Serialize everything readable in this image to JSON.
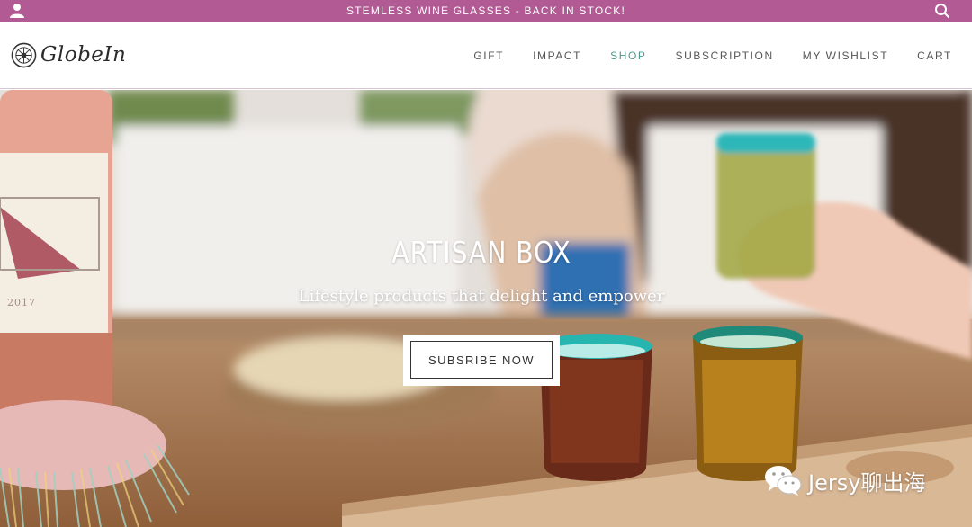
{
  "announcement": {
    "text": "STEMLESS WINE GLASSES - BACK IN STOCK!",
    "bar_color": "#b15a93"
  },
  "header": {
    "logo_text": "GlobeIn",
    "nav": [
      {
        "label": "GIFT",
        "active": false
      },
      {
        "label": "IMPACT",
        "active": false
      },
      {
        "label": "SHOP",
        "active": true
      },
      {
        "label": "SUBSCRIPTION",
        "active": false
      },
      {
        "label": "MY WISHLIST",
        "active": false
      },
      {
        "label": "CART",
        "active": false
      }
    ],
    "active_color": "#4d9a8a"
  },
  "hero": {
    "title": "ARTISAN BOX",
    "subtitle": "Lifestyle products that delight and empower",
    "cta_label": "SUBSRIBE NOW"
  },
  "watermark": {
    "text": "Jersy聊出海",
    "icon": "wechat-icon"
  },
  "icons": {
    "user": "user-icon",
    "search": "search-icon",
    "logo": "globe-logo-icon"
  }
}
